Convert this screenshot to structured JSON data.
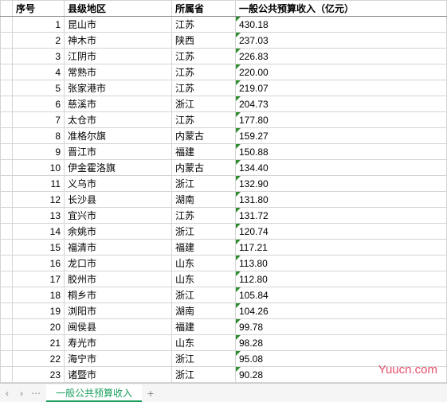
{
  "headers": {
    "index": "序号",
    "region": "县级地区",
    "province": "所属省",
    "revenue": "一般公共预算收入（亿元）"
  },
  "rows": [
    {
      "idx": "1",
      "region": "昆山市",
      "prov": "江苏",
      "rev": "430.18"
    },
    {
      "idx": "2",
      "region": "神木市",
      "prov": "陕西",
      "rev": "237.03"
    },
    {
      "idx": "3",
      "region": "江阴市",
      "prov": "江苏",
      "rev": "226.83"
    },
    {
      "idx": "4",
      "region": "常熟市",
      "prov": "江苏",
      "rev": "220.00"
    },
    {
      "idx": "5",
      "region": "张家港市",
      "prov": "江苏",
      "rev": "219.07"
    },
    {
      "idx": "6",
      "region": "慈溪市",
      "prov": "浙江",
      "rev": "204.73"
    },
    {
      "idx": "7",
      "region": "太仓市",
      "prov": "江苏",
      "rev": "177.80"
    },
    {
      "idx": "8",
      "region": "准格尔旗",
      "prov": "内蒙古",
      "rev": "159.27"
    },
    {
      "idx": "9",
      "region": "晋江市",
      "prov": "福建",
      "rev": "150.88"
    },
    {
      "idx": "10",
      "region": "伊金霍洛旗",
      "prov": "内蒙古",
      "rev": "134.40"
    },
    {
      "idx": "11",
      "region": "义乌市",
      "prov": "浙江",
      "rev": "132.90"
    },
    {
      "idx": "12",
      "region": "长沙县",
      "prov": "湖南",
      "rev": "131.80"
    },
    {
      "idx": "13",
      "region": "宜兴市",
      "prov": "江苏",
      "rev": "131.72"
    },
    {
      "idx": "14",
      "region": "余姚市",
      "prov": "浙江",
      "rev": "120.74"
    },
    {
      "idx": "15",
      "region": "福清市",
      "prov": "福建",
      "rev": "117.21"
    },
    {
      "idx": "16",
      "region": "龙口市",
      "prov": "山东",
      "rev": "113.80"
    },
    {
      "idx": "17",
      "region": "胶州市",
      "prov": "山东",
      "rev": "112.80"
    },
    {
      "idx": "18",
      "region": "桐乡市",
      "prov": "浙江",
      "rev": "105.84"
    },
    {
      "idx": "19",
      "region": "浏阳市",
      "prov": "湖南",
      "rev": "104.26"
    },
    {
      "idx": "20",
      "region": "闽侯县",
      "prov": "福建",
      "rev": "99.78"
    },
    {
      "idx": "21",
      "region": "寿光市",
      "prov": "山东",
      "rev": "98.28"
    },
    {
      "idx": "22",
      "region": "海宁市",
      "prov": "浙江",
      "rev": "95.08"
    },
    {
      "idx": "23",
      "region": "诸暨市",
      "prov": "浙江",
      "rev": "90.28"
    }
  ],
  "tab": {
    "name": "一般公共预算收入"
  },
  "nav": {
    "prev": "‹",
    "next": "›",
    "more": "⋯",
    "add": "+"
  },
  "watermark": "Yuucn.com",
  "chart_data": {
    "type": "table",
    "title": "一般公共预算收入（亿元）",
    "columns": [
      "序号",
      "县级地区",
      "所属省",
      "一般公共预算收入（亿元）"
    ],
    "data": [
      [
        1,
        "昆山市",
        "江苏",
        430.18
      ],
      [
        2,
        "神木市",
        "陕西",
        237.03
      ],
      [
        3,
        "江阴市",
        "江苏",
        226.83
      ],
      [
        4,
        "常熟市",
        "江苏",
        220.0
      ],
      [
        5,
        "张家港市",
        "江苏",
        219.07
      ],
      [
        6,
        "慈溪市",
        "浙江",
        204.73
      ],
      [
        7,
        "太仓市",
        "江苏",
        177.8
      ],
      [
        8,
        "准格尔旗",
        "内蒙古",
        159.27
      ],
      [
        9,
        "晋江市",
        "福建",
        150.88
      ],
      [
        10,
        "伊金霍洛旗",
        "内蒙古",
        134.4
      ],
      [
        11,
        "义乌市",
        "浙江",
        132.9
      ],
      [
        12,
        "长沙县",
        "湖南",
        131.8
      ],
      [
        13,
        "宜兴市",
        "江苏",
        131.72
      ],
      [
        14,
        "余姚市",
        "浙江",
        120.74
      ],
      [
        15,
        "福清市",
        "福建",
        117.21
      ],
      [
        16,
        "龙口市",
        "山东",
        113.8
      ],
      [
        17,
        "胶州市",
        "山东",
        112.8
      ],
      [
        18,
        "桐乡市",
        "浙江",
        105.84
      ],
      [
        19,
        "浏阳市",
        "湖南",
        104.26
      ],
      [
        20,
        "闽侯县",
        "福建",
        99.78
      ],
      [
        21,
        "寿光市",
        "山东",
        98.28
      ],
      [
        22,
        "海宁市",
        "浙江",
        95.08
      ],
      [
        23,
        "诸暨市",
        "浙江",
        90.28
      ]
    ]
  }
}
